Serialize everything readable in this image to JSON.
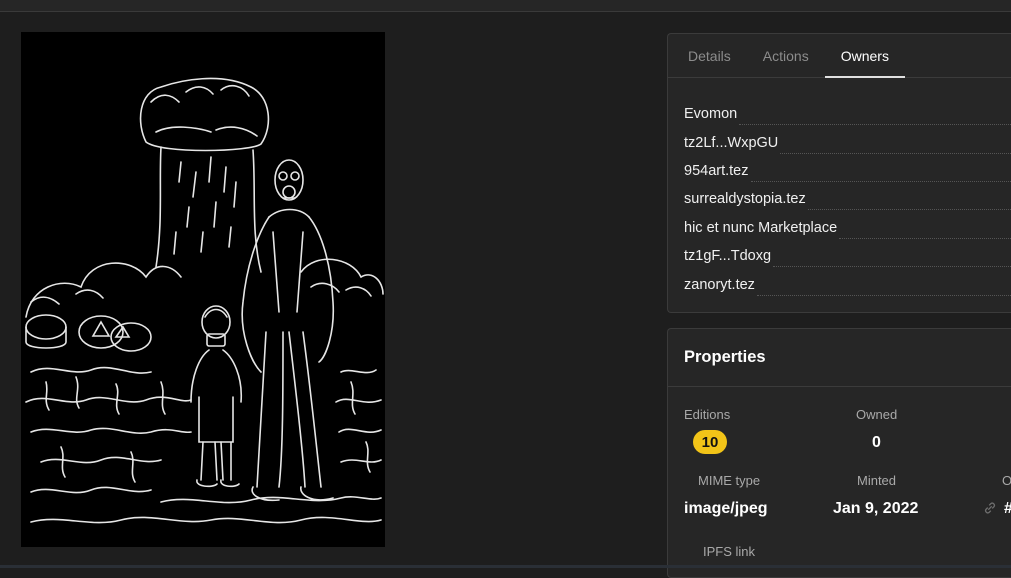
{
  "tabs": [
    {
      "label": "Details",
      "active": false
    },
    {
      "label": "Actions",
      "active": false
    },
    {
      "label": "Owners",
      "active": true
    }
  ],
  "owners": [
    "Evomon",
    "tz2Lf...WxpGU",
    "954art.tez",
    "surrealdystopia.tez",
    "hic et nunc Marketplace",
    "tz1gF...Tdoxg",
    "zanoryt.tez"
  ],
  "properties": {
    "title": "Properties",
    "editions_label": "Editions",
    "editions_value": "10",
    "owned_label": "Owned",
    "owned_value": "0",
    "mime_label": "MIME type",
    "mime_value": "image/jpeg",
    "minted_label": "Minted",
    "minted_value": "Jan 9, 2022",
    "ipfs_label": "IPFS link",
    "partial_label": "O",
    "partial_value": "#"
  },
  "colors": {
    "badge": "#f2c418",
    "background": "#1e1e1e",
    "panel": "#262626"
  },
  "icons": {
    "link": "link-icon"
  }
}
